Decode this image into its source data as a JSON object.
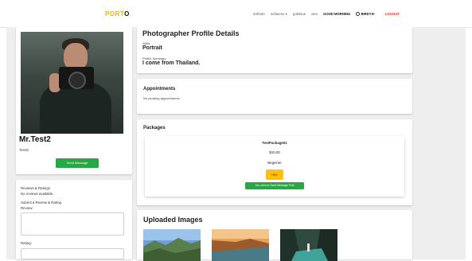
{
  "navbar": {
    "brand_part1": "PORT",
    "brand_part2": "O",
    "links": [
      "sUfredn",
      "notfuerne ▾",
      "gobisrue",
      "wen"
    ],
    "greeting": "GOOD MORNING",
    "username": "BIRDYS!",
    "logout": "LOGOUT"
  },
  "profile": {
    "name": "Mr.Test2",
    "username": "Test02",
    "send_message_label": "Send Message"
  },
  "reviews": {
    "title": "Reviews & Ratings",
    "empty_text": "No reviews available.",
    "submit_title": "Submit a Review & Rating",
    "review_label": "Review:",
    "rating_label": "Rating:"
  },
  "details": {
    "title": "Photographer Profile Details",
    "skills_label": "Skills",
    "skills_value": "Portrait",
    "summary_label": "Profile Summary",
    "summary_value": "I come from Thailand."
  },
  "appointments": {
    "title": "Appointments",
    "empty_text": "No pending appointments."
  },
  "packages": {
    "title": "Packages",
    "items": [
      {
        "name": "TestPackage01",
        "price": "$10.00",
        "level": "Beginner",
        "hire_label": "Hire",
        "notice": "You need to Send Message First"
      }
    ]
  },
  "uploaded": {
    "title": "Uploaded Images"
  },
  "colors": {
    "accent_yellow": "#f4b400",
    "logout_red": "#d93025",
    "success_green": "#28a745",
    "hire_yellow": "#ffc107"
  }
}
